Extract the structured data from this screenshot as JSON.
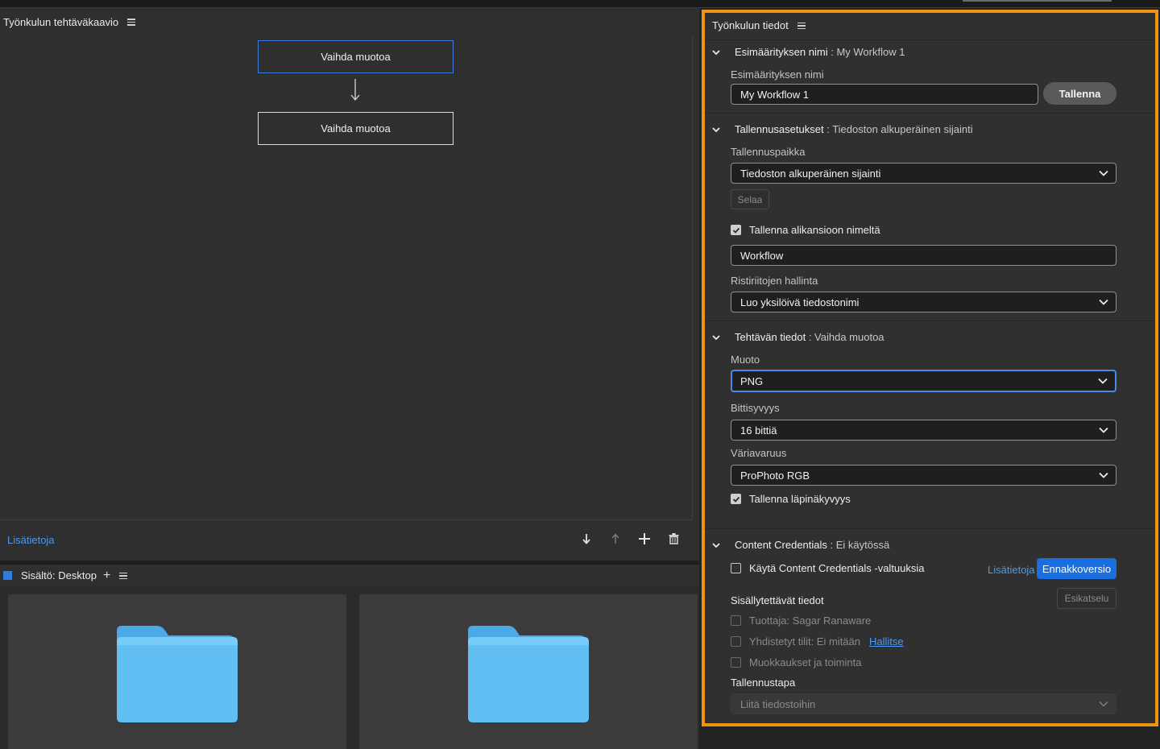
{
  "workflow_chart": {
    "title": "Työnkulun tehtäväkaavio",
    "nodes": [
      {
        "label": "Vaihda muotoa",
        "selected": true
      },
      {
        "label": "Vaihda muotoa",
        "selected": false
      }
    ],
    "footer_link": "Lisätietoja",
    "tools": [
      "move-down-icon",
      "move-up-icon",
      "add-icon",
      "trash-icon"
    ]
  },
  "content": {
    "title": "Sisältö: Desktop",
    "items": [
      "folder-icon",
      "folder-icon"
    ]
  },
  "details": {
    "title": "Työnkulun tiedot",
    "preset": {
      "heading": "Esimäärityksen nimi",
      "heading_value": ": My Workflow 1",
      "name_label": "Esimäärityksen nimi",
      "name_value": "My Workflow 1",
      "save_button": "Tallenna"
    },
    "save_settings": {
      "heading": "Tallennusasetukset",
      "heading_value": ": Tiedoston alkuperäinen sijainti",
      "location_label": "Tallennuspaikka",
      "location_value": "Tiedoston alkuperäinen sijainti",
      "browse_button": "Selaa",
      "subfolder_label": "Tallenna alikansioon nimeltä",
      "subfolder_checked": true,
      "subfolder_value": "Workflow",
      "conflict_label": "Ristiriitojen hallinta",
      "conflict_value": "Luo yksilöivä tiedostonimi"
    },
    "task": {
      "heading": "Tehtävän tiedot",
      "heading_value": ": Vaihda muotoa",
      "format_label": "Muoto",
      "format_value": "PNG",
      "bitdepth_label": "Bittisyvyys",
      "bitdepth_value": "16 bittiä",
      "colorspace_label": "Väriavaruus",
      "colorspace_value": "ProPhoto RGB",
      "transparency_label": "Tallenna läpinäkyvyys",
      "transparency_checked": true
    },
    "credentials": {
      "heading": "Content Credentials",
      "heading_value": ": Ei käytössä",
      "use_label": "Käytä Content Credentials -valtuuksia",
      "use_checked": false,
      "learn_more": "Lisätietoja",
      "beta_button": "Ennakkoversio",
      "included_label": "Sisällytettävät tiedot",
      "preview_button": "Esikatselu",
      "producer_label": "Tuottaja: Sagar Ranaware",
      "accounts_label": "Yhdistetyt tilit: Ei mitään",
      "manage_link": "Hallitse",
      "edits_label": "Muokkaukset ja toiminta",
      "method_label": "Tallennustapa",
      "method_value": "Liitä tiedostoihin"
    }
  },
  "colors": {
    "highlight_border": "#f29212",
    "accent_blue": "#1a6ee0",
    "folder_blue": "#5cb8f0"
  }
}
